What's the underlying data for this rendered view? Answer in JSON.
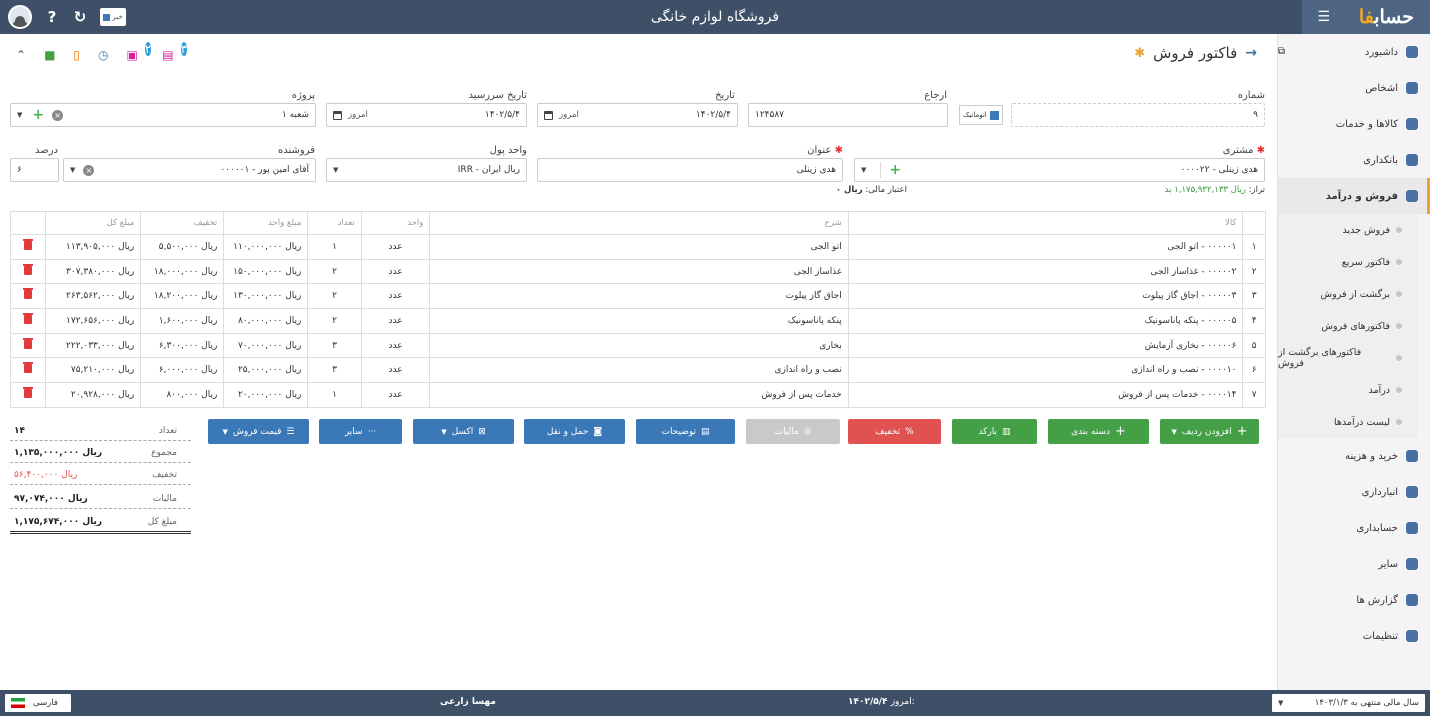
{
  "topbar": {
    "title": "فروشگاه لوازم خانگی",
    "brand_main": "حساب",
    "brand_accent": "فا",
    "news_label": "خبر"
  },
  "sidebar": {
    "items": [
      {
        "label": "داشبورد"
      },
      {
        "label": "اشخاص"
      },
      {
        "label": "کالاها و خدمات"
      },
      {
        "label": "بانکداری"
      },
      {
        "label": "فروش و درآمد"
      }
    ],
    "sub": [
      "فروش جدید",
      "فاکتور سریع",
      "برگشت از فروش",
      "فاکتورهای فروش",
      "فاکتورهای برگشت از فروش",
      "درآمد",
      "لیست درآمدها"
    ],
    "items2": [
      {
        "label": "خرید و هزینه"
      },
      {
        "label": "انبارداری"
      },
      {
        "label": "حسابداری"
      },
      {
        "label": "سایر"
      },
      {
        "label": "گزارش ها"
      },
      {
        "label": "تنظیمات"
      }
    ]
  },
  "page": {
    "title": "فاکتور فروش",
    "badges": [
      "۲",
      "۳"
    ]
  },
  "form": {
    "number_label": "شماره",
    "number_value": "۹",
    "auto_label": "اتوماتیک",
    "ref_label": "ارجاع",
    "ref_value": "۱۲۴۵۸۷",
    "date_label": "تاریخ",
    "date_value": "۱۴۰۲/۵/۴",
    "today": "امروز",
    "due_label": "تاریخ سررسید",
    "due_value": "۱۴۰۲/۵/۴",
    "project_label": "پروژه",
    "project_value": "شعبه ۱",
    "customer_label": "مشتری",
    "customer_value": "۰۰۰۰۲۲ - هدی زینلی",
    "title_label": "عنوان",
    "title_value": "هدی زینلی",
    "currency_label": "واحد پول",
    "currency_value": "IRR - ریال ایران",
    "seller_label": "فروشنده",
    "seller_value": "۰۰۰۰۰۱ - آقای امین پور",
    "percent_label": "درصد",
    "percent_value": "۶",
    "balance_prefix": "تراز:",
    "balance_value": "ریال ۱,۱۷۵,۹۳۲,۱۳۳ بد",
    "credit_label": "اعتبار مالی:",
    "credit_value": "ریال ۰"
  },
  "table": {
    "headers": [
      "کالا",
      "شرح",
      "واحد",
      "تعداد",
      "مبلغ واحد",
      "تخفیف",
      "مبلغ کل"
    ],
    "rows": [
      {
        "n": "۱",
        "item": "۰۰۰۰۰۱ - اتو الجی",
        "desc": "اتو الجی",
        "unit": "عدد",
        "qty": "۱",
        "price": "ریال ۱۱۰,۰۰۰,۰۰۰",
        "disc": "ریال ۵,۵۰۰,۰۰۰",
        "total": "ریال ۱۱۳,۹۰۵,۰۰۰"
      },
      {
        "n": "۲",
        "item": "۰۰۰۰۰۲ - غذاساز الجی",
        "desc": "غذاساز الجی",
        "unit": "عدد",
        "qty": "۲",
        "price": "ریال ۱۵۰,۰۰۰,۰۰۰",
        "disc": "ریال ۱۸,۰۰۰,۰۰۰",
        "total": "ریال ۳۰۷,۳۸۰,۰۰۰"
      },
      {
        "n": "۳",
        "item": "۰۰۰۰۰۳ - اجاق گاز پیلوت",
        "desc": "اجاق گاز پیلوت",
        "unit": "عدد",
        "qty": "۲",
        "price": "ریال ۱۳۰,۰۰۰,۰۰۰",
        "disc": "ریال ۱۸,۲۰۰,۰۰۰",
        "total": "ریال ۲۶۳,۵۶۲,۰۰۰"
      },
      {
        "n": "۴",
        "item": "۰۰۰۰۰۵ - پنکه پاناسونیک",
        "desc": "پنکه پاناسونیک",
        "unit": "عدد",
        "qty": "۲",
        "price": "ریال ۸۰,۰۰۰,۰۰۰",
        "disc": "ریال ۱,۶۰۰,۰۰۰",
        "total": "ریال ۱۷۲,۶۵۶,۰۰۰"
      },
      {
        "n": "۵",
        "item": "۰۰۰۰۰۶ - بخاری آزمایش",
        "desc": "بخاری",
        "unit": "عدد",
        "qty": "۳",
        "price": "ریال ۷۰,۰۰۰,۰۰۰",
        "disc": "ریال ۶,۳۰۰,۰۰۰",
        "total": "ریال ۲۲۲,۰۳۳,۰۰۰"
      },
      {
        "n": "۶",
        "item": "۰۰۰۰۱۰ - نصب و راه اندازی",
        "desc": "نصب و راه اندازی",
        "unit": "عدد",
        "qty": "۳",
        "price": "ریال ۲۵,۰۰۰,۰۰۰",
        "disc": "ریال ۶,۰۰۰,۰۰۰",
        "total": "ریال ۷۵,۲۱۰,۰۰۰"
      },
      {
        "n": "۷",
        "item": "۰۰۰۰۱۴ - خدمات پس از فروش",
        "desc": "خدمات پس از فروش",
        "unit": "عدد",
        "qty": "۱",
        "price": "ریال ۲۰,۰۰۰,۰۰۰",
        "disc": "ریال ۸۰۰,۰۰۰",
        "total": "ریال ۲۰,۹۲۸,۰۰۰"
      }
    ]
  },
  "buttons": {
    "add_row": "افزودن ردیف",
    "categorize": "دسته بندی",
    "barcode": "بارکد",
    "discount": "تخفیف",
    "tax": "مالیات",
    "notes": "توضیحات",
    "shipping": "حمل و نقل",
    "excel": "اکسل",
    "other": "سایر",
    "sale_price": "قیمت فروش"
  },
  "totals": {
    "count_label": "تعداد",
    "count_value": "۱۴",
    "sum_label": "مجموع",
    "sum_value": "ریال ۱,۱۳۵,۰۰۰,۰۰۰",
    "discount_label": "تخفیف",
    "discount_value": "ریال ۵۶,۴۰۰,۰۰۰",
    "tax_label": "مالیات",
    "tax_value": "ریال ۹۷,۰۷۴,۰۰۰",
    "total_label": "مبلغ کل",
    "total_value": "ریال ۱,۱۷۵,۶۷۴,۰۰۰"
  },
  "footer": {
    "fiscal_year": "سال مالی منتهی به ۱۴۰۳/۱/۳",
    "today_label": "امروز:",
    "today_value": "۱۴۰۲/۵/۴",
    "user": "مهسا زارعی",
    "language": "فارسی"
  },
  "colors": {
    "topbar": "#3e5068",
    "accent": "#f0a030",
    "green": "#43a047",
    "red": "#e05252",
    "blue": "#3a78b8"
  }
}
